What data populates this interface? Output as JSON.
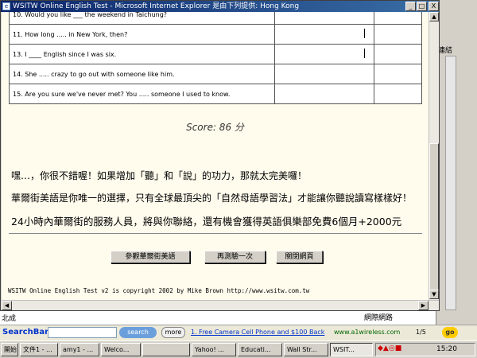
{
  "background": {
    "right_label": "連結",
    "net_status": "網際網路",
    "left_status": "北成"
  },
  "window": {
    "title": "WSITW Online English Test - Microsoft Internet Explorer 是由下列提供: Hong Kong",
    "controls": {
      "minimize": "_",
      "maximize": "□",
      "close": "X"
    }
  },
  "questions": [
    {
      "text": "10. Would you like ___ the weekend in Taichung?"
    },
    {
      "text": "11. How long ..... in New York, then?"
    },
    {
      "text": "13. I ____ English since I was six."
    },
    {
      "text": "14. She ..... crazy to go out with someone like him."
    },
    {
      "text": "15. Are you sure we've never met? You ..... someone I used to know."
    }
  ],
  "score": "Score: 86 分",
  "messages": {
    "line1": "嘿…，你很不錯喔！如果增加「聽」和「說」的功力，那就太完美囉！",
    "line2": "華爾街美語是你唯一的選擇，只有全球最頂尖的「自然母語學習法」才能讓你聽說讀寫樣樣好！",
    "line3": "24小時內華爾街的服務人員，將與你聯絡，還有機會獲得英語俱樂部免費6個月+2000元"
  },
  "buttons": {
    "visit": "參觀華爾街美語",
    "retry": "再測驗一次",
    "close": "關閉網頁"
  },
  "copyright": "WSITW Online English Test v2 is copyright 2002 by Mike Brown http://www.wsitw.com.tw",
  "searchbar": {
    "label": "SearchBar",
    "search_button": "search",
    "more_button": "more",
    "ad_link": "1. Free Camera Cell Phone and $100 Back",
    "ad_url": "www.a1wireless.com",
    "count": "1/5",
    "go": "go"
  },
  "taskbar": {
    "tasks": [
      "開始",
      "文件1 - ...",
      "amy1 - ...",
      "Welco...",
      "",
      "Yahoo! ...",
      "Educati...",
      "Wall Str...",
      "WSIT..."
    ],
    "clock": "15:20"
  }
}
